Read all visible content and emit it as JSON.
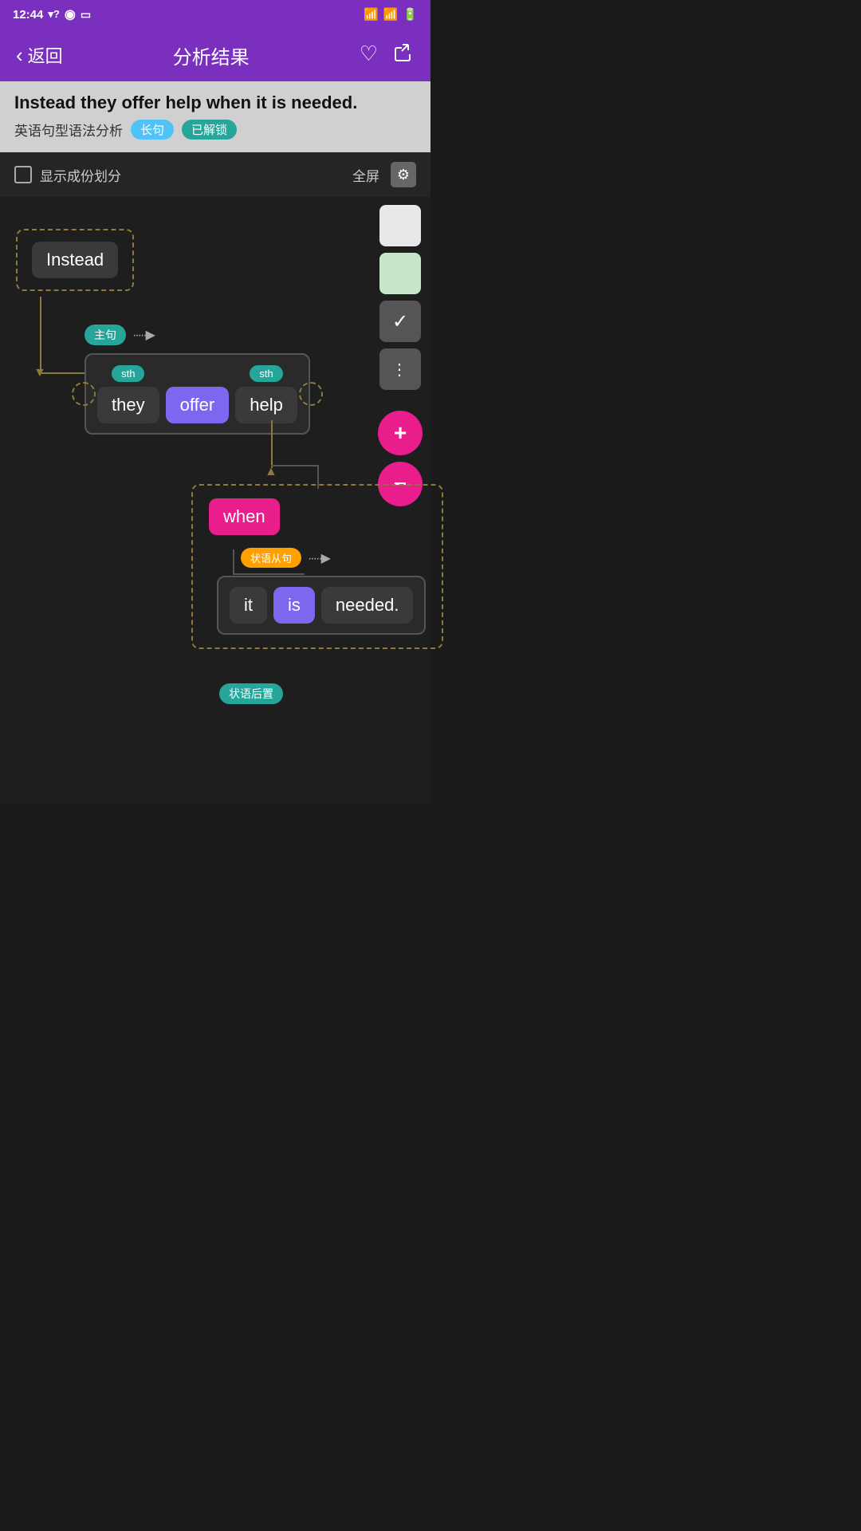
{
  "statusBar": {
    "time": "12:44",
    "icons": [
      "signal",
      "question",
      "circle-logo",
      "sim"
    ]
  },
  "topBar": {
    "backLabel": "返回",
    "title": "分析结果",
    "heartIcon": "♡",
    "shareIcon": "↗"
  },
  "sentenceHeader": {
    "sentence": "Instead they offer help when it is needed.",
    "metaLabel": "英语句型语法分析",
    "badge1": "长句",
    "badge2": "已解锁"
  },
  "controls": {
    "checkboxLabel": "显示成份划分",
    "fullscreenLabel": "全屏",
    "gearIcon": "⚙"
  },
  "diagram": {
    "insteadWord": "Instead",
    "mainClauseLabel": "主句",
    "sthLabel1": "sth",
    "sthLabel2": "sth",
    "word1": "they",
    "word2": "offer",
    "word3": "help",
    "advClauseLabel": "状语从句",
    "whenWord": "when",
    "word4": "it",
    "word5": "is",
    "word6": "needed",
    "period": ".",
    "advPostLabel": "状语后置"
  },
  "rightTools": {
    "btn1": "white",
    "btn2": "lightgreen",
    "btn3": "checkmark",
    "btn4": "dots",
    "plusBtn": "+",
    "minusBtn": "−"
  }
}
